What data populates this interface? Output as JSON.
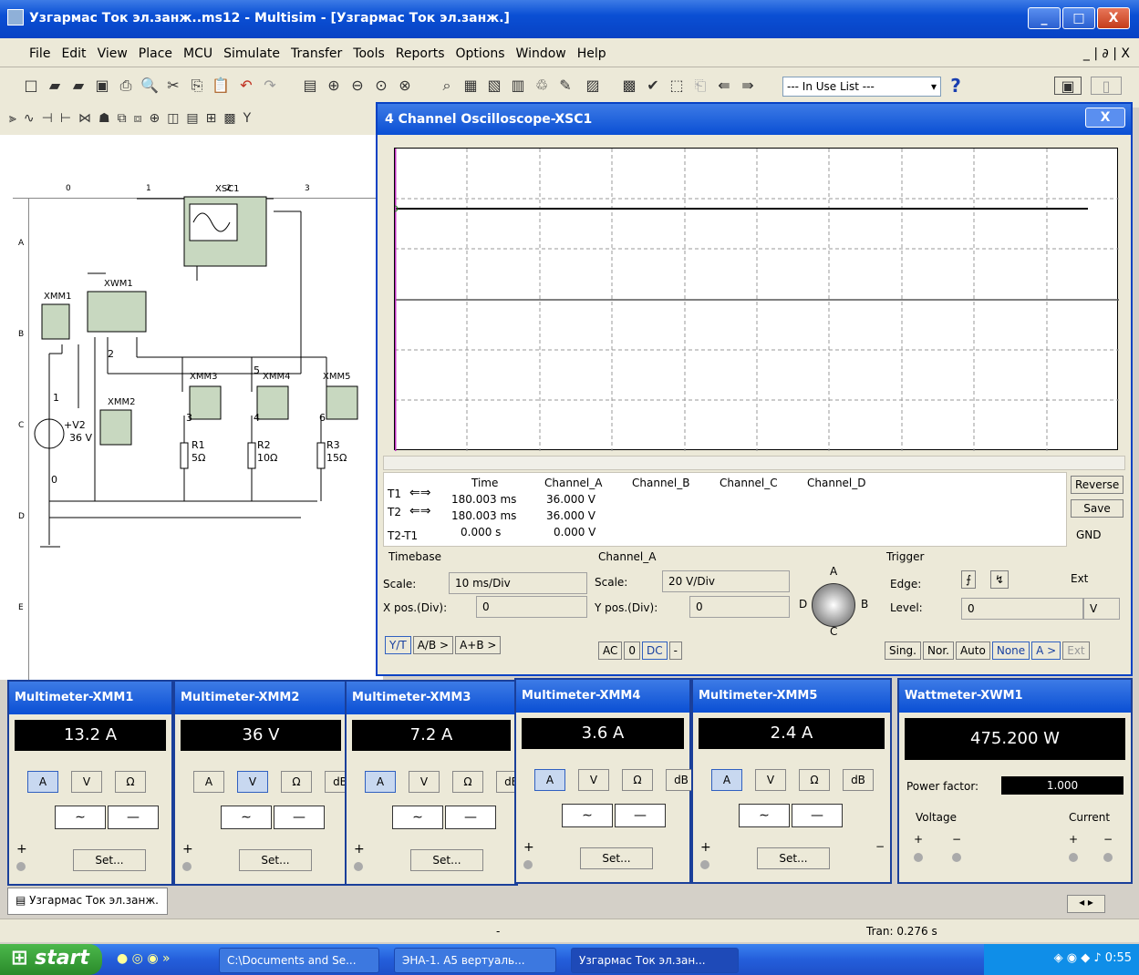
{
  "window": {
    "title": "Узгармас Ток эл.занж..ms12 - Multisim - [Узгармас Ток эл.занж.]",
    "min": "_",
    "max": "□",
    "close": "X"
  },
  "menu": {
    "items": [
      "File",
      "Edit",
      "View",
      "Place",
      "MCU",
      "Simulate",
      "Transfer",
      "Tools",
      "Reports",
      "Options",
      "Window",
      "Help"
    ],
    "mdi_controls": "_ | ∂ | X"
  },
  "toolbar": {
    "in_use_list": "--- In Use List ---",
    "help": "?"
  },
  "ruler": {
    "cols": [
      "0",
      "1",
      "2",
      "3"
    ],
    "rows": [
      "A",
      "B",
      "C",
      "D",
      "E"
    ]
  },
  "circuit": {
    "xsc1": "XSC1",
    "xwm1": "XWM1",
    "xmm1": "XMM1",
    "xmm2": "XMM2",
    "xmm3": "XMM3",
    "xmm4": "XMM4",
    "xmm5": "XMM5",
    "v2_label": "+V2",
    "v2_value": "36 V",
    "r1": "R1",
    "r1v": "5Ω",
    "r2": "R2",
    "r2v": "10Ω",
    "r3": "R3",
    "r3v": "15Ω",
    "n0": "0",
    "n1": "1",
    "n2": "2",
    "n3": "3",
    "n4": "4",
    "n5": "5",
    "n6": "6"
  },
  "oscilloscope": {
    "title": "4 Channel Oscilloscope-XSC1",
    "headers": [
      "Time",
      "Channel_A",
      "Channel_B",
      "Channel_C",
      "Channel_D"
    ],
    "t1": {
      "label": "T1",
      "time": "180.003 ms",
      "a": "36.000 V"
    },
    "t2": {
      "label": "T2",
      "time": "180.003 ms",
      "a": "36.000 V"
    },
    "t21": {
      "label": "T2-T1",
      "time": "0.000 s",
      "a": "0.000 V"
    },
    "reverse": "Reverse",
    "save": "Save",
    "gnd": "GND",
    "timebase": {
      "group": "Timebase",
      "scale_label": "Scale:",
      "scale": "10 ms/Div",
      "xpos_label": "X pos.(Div):",
      "xpos": "0",
      "yt": "Y/T",
      "ab": "A/B >",
      "apb": "A+B >"
    },
    "channel": {
      "group": "Channel_A",
      "scale_label": "Scale:",
      "scale": "20  V/Div",
      "ypos_label": "Y pos.(Div):",
      "ypos": "0",
      "ac": "AC",
      "zero": "0",
      "dc": "DC",
      "minus": "-",
      "knob_a": "A",
      "knob_b": "B",
      "knob_c": "C",
      "knob_d": "D"
    },
    "trigger": {
      "group": "Trigger",
      "edge_label": "Edge:",
      "ext": "Ext",
      "level_label": "Level:",
      "level": "0",
      "unit": "V",
      "sing": "Sing.",
      "nor": "Nor.",
      "auto": "Auto",
      "none": "None",
      "a": "A >",
      "extbtn": "Ext"
    }
  },
  "multimeters": [
    {
      "title": "Multimeter-XMM1",
      "value": "13.2 A",
      "mode": "A"
    },
    {
      "title": "Multimeter-XMM2",
      "value": "36 V",
      "mode": "V"
    },
    {
      "title": "Multimeter-XMM3",
      "value": "7.2 A",
      "mode": "A"
    },
    {
      "title": "Multimeter-XMM4",
      "value": "3.6 A",
      "mode": "A"
    },
    {
      "title": "Multimeter-XMM5",
      "value": "2.4 A",
      "mode": "A"
    }
  ],
  "mm_buttons": {
    "a": "A",
    "v": "V",
    "ohm": "Ω",
    "db": "dB",
    "ac": "∼",
    "dc": "—",
    "set": "Set...",
    "plus": "+",
    "minus": "−"
  },
  "wattmeter": {
    "title": "Wattmeter-XWM1",
    "value": "475.200 W",
    "pf_label": "Power factor:",
    "pf": "1.000",
    "voltage": "Voltage",
    "current": "Current",
    "plus": "+",
    "minus": "−"
  },
  "tab": {
    "label": "Узгармас Ток эл.занж."
  },
  "status": {
    "dash": "-",
    "tran": "Tran: 0.276 s"
  },
  "taskbar": {
    "start": "start",
    "t1": "C:\\Documents and Se...",
    "t2": "ЭНА-1. А5 вертуаль...",
    "t3": "Узгармас Ток эл.зан...",
    "time": "0:55"
  }
}
